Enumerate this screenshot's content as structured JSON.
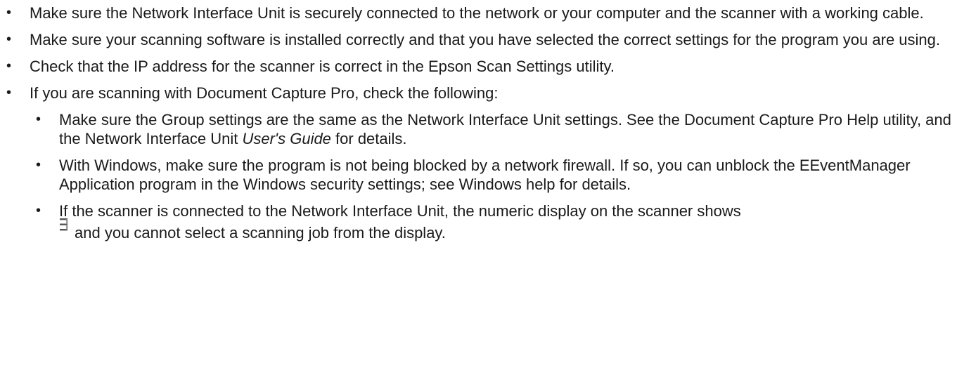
{
  "bullet_char": "•",
  "items": [
    {
      "text": "Make sure the Network Interface Unit is securely connected to the network or your computer and the scanner with a working cable."
    },
    {
      "text": "Make sure your scanning software is installed correctly and that you have selected the correct settings for the program you are using."
    },
    {
      "text": "Check that the IP address for the scanner is correct in the Epson Scan Settings utility."
    },
    {
      "text": "If you are scanning with Document Capture Pro, check the following:",
      "subitems": [
        {
          "text_before": "Make sure the Group settings are the same as the Network Interface Unit settings. See the Document Capture Pro Help utility, and the Network Interface Unit ",
          "text_italic": "User's Guide",
          "text_after": " for details."
        },
        {
          "text": "With Windows, make sure the program is not being blocked by a network firewall. If so, you can unblock the EEventManager Application program in the Windows security settings; see Windows help for details."
        },
        {
          "text_before": "If the scanner is connected to the Network Interface Unit, the numeric display on the scanner shows",
          "icon": "segment-display-icon",
          "text_after": "and you cannot select a scanning job from the display."
        }
      ]
    }
  ]
}
